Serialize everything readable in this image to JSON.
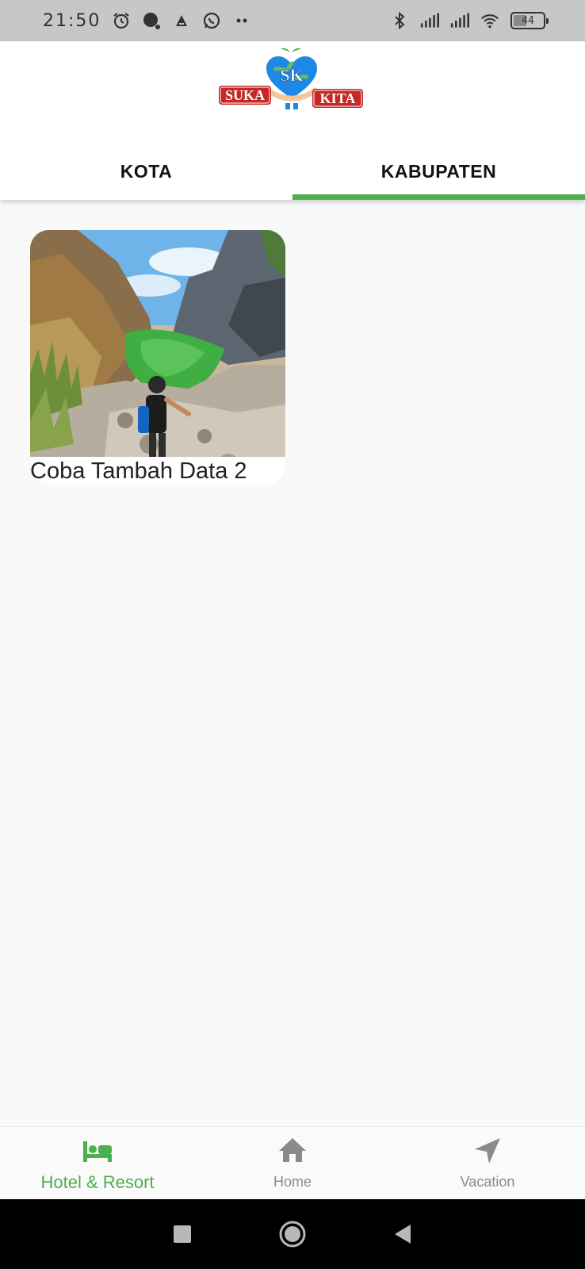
{
  "status_bar": {
    "time": "21:50",
    "battery": "44",
    "battery_level": 0.44,
    "icons_left": [
      "alarm-icon",
      "notification-dot-icon",
      "app-a-icon",
      "whatsapp-icon",
      "more-dots-icon"
    ],
    "icons_right": [
      "bluetooth-icon",
      "signal-icon",
      "signal-icon",
      "wifi-icon",
      "battery-icon"
    ]
  },
  "header": {
    "logo_text_left": "SUKA",
    "logo_text_right": "KITA",
    "logo_monogram": "SK"
  },
  "tabs": [
    {
      "label": "KOTA",
      "active": false
    },
    {
      "label": "KABUPATEN",
      "active": true
    }
  ],
  "cards": [
    {
      "title": "Coba Tambah Data 2"
    }
  ],
  "bottom_nav": [
    {
      "label": "Hotel & Resort",
      "icon": "bed-icon",
      "active": true
    },
    {
      "label": "Home",
      "icon": "home-icon",
      "active": false
    },
    {
      "label": "Vacation",
      "icon": "navigation-arrow-icon",
      "active": false
    }
  ],
  "colors": {
    "accent": "#4caf50",
    "inactive": "#8a8a8a",
    "status_bar": "#c7c7c7"
  }
}
